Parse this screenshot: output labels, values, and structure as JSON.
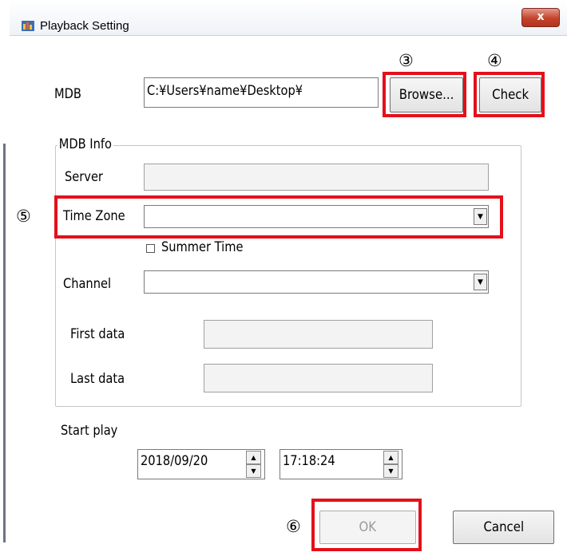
{
  "window": {
    "title": "Playback Setting",
    "close_glyph": "x"
  },
  "mdb": {
    "label": "MDB",
    "path_value": "C:¥Users¥name¥Desktop¥",
    "browse_label": "Browse...",
    "check_label": "Check"
  },
  "mdb_info": {
    "group_label": "MDB Info",
    "server_label": "Server",
    "server_value": "",
    "timezone_label": "Time Zone",
    "timezone_value": "",
    "summer_time_label": "Summer Time",
    "summer_time_checked": false,
    "channel_label": "Channel",
    "channel_value": "",
    "first_data_label": "First data",
    "first_data_value": "",
    "last_data_label": "Last data",
    "last_data_value": ""
  },
  "start_play": {
    "label": "Start play",
    "date": "2018/09/20",
    "time": "17:18:24"
  },
  "buttons": {
    "ok_label": "OK",
    "cancel_label": "Cancel"
  },
  "annotations": {
    "n3": "③",
    "n4": "④",
    "n5": "⑤",
    "n6": "⑥",
    "highlight_color": "#e4101a"
  },
  "icons": {
    "dropdown": "▼",
    "spin_up": "▲",
    "spin_down": "▼"
  }
}
